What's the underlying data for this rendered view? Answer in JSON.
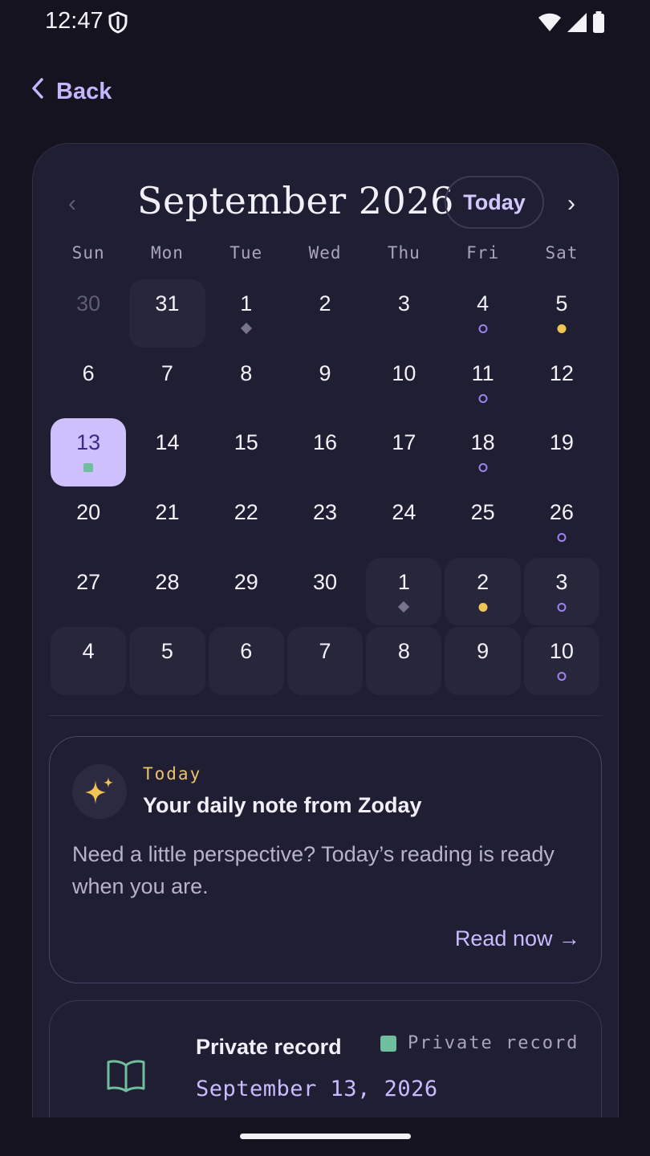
{
  "status_bar": {
    "time": "12:47"
  },
  "back_label": "Back",
  "calendar": {
    "month_title": "September 2026",
    "today_label": "Today",
    "prev_label": "‹",
    "next_label": "›",
    "weekdays": [
      "Sun",
      "Mon",
      "Tue",
      "Wed",
      "Thu",
      "Fri",
      "Sat"
    ],
    "days": [
      {
        "label": "30",
        "muted": true
      },
      {
        "label": "31",
        "outside": true
      },
      {
        "label": "1",
        "marker": "diamond"
      },
      {
        "label": "2"
      },
      {
        "label": "3"
      },
      {
        "label": "4",
        "marker": "ring"
      },
      {
        "label": "5",
        "marker": "dot"
      },
      {
        "label": "6"
      },
      {
        "label": "7"
      },
      {
        "label": "8"
      },
      {
        "label": "9"
      },
      {
        "label": "10"
      },
      {
        "label": "11",
        "marker": "ring"
      },
      {
        "label": "12"
      },
      {
        "label": "13",
        "selected": true,
        "marker": "square"
      },
      {
        "label": "14"
      },
      {
        "label": "15"
      },
      {
        "label": "16"
      },
      {
        "label": "17"
      },
      {
        "label": "18",
        "marker": "ring"
      },
      {
        "label": "19"
      },
      {
        "label": "20"
      },
      {
        "label": "21"
      },
      {
        "label": "22"
      },
      {
        "label": "23"
      },
      {
        "label": "24"
      },
      {
        "label": "25"
      },
      {
        "label": "26",
        "marker": "ring"
      },
      {
        "label": "27"
      },
      {
        "label": "28"
      },
      {
        "label": "29"
      },
      {
        "label": "30"
      },
      {
        "label": "1",
        "outside": true,
        "marker": "diamond"
      },
      {
        "label": "2",
        "outside": true,
        "marker": "dot"
      },
      {
        "label": "3",
        "outside": true,
        "marker": "ring"
      },
      {
        "label": "4",
        "outside": true
      },
      {
        "label": "5",
        "outside": true
      },
      {
        "label": "6",
        "outside": true
      },
      {
        "label": "7",
        "outside": true
      },
      {
        "label": "8",
        "outside": true
      },
      {
        "label": "9",
        "outside": true
      },
      {
        "label": "10",
        "outside": true,
        "marker": "ring"
      }
    ]
  },
  "daily_note": {
    "kicker": "Today",
    "title": "Your daily note from Zoday",
    "body": "Need a little perspective? Today’s reading is ready when you are.",
    "link": "Read now →"
  },
  "record": {
    "title": "Private record",
    "tag": "Private record",
    "date": "September 13, 2026"
  },
  "colors": {
    "accent": "#c4b5fd",
    "selected_bg": "#cec0fc",
    "marker_ring": "#9d82f2",
    "marker_dot": "#f0c455",
    "marker_square": "#6fbf9f"
  }
}
